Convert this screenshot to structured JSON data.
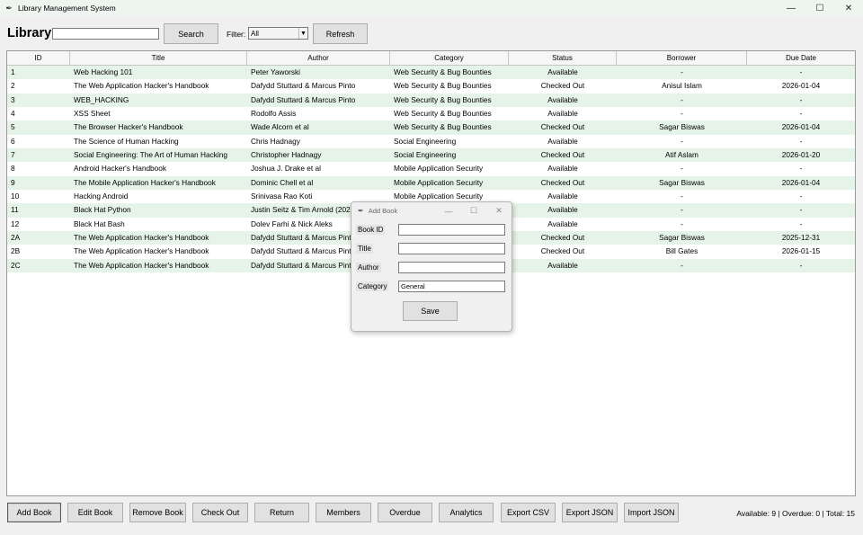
{
  "window": {
    "title": "Library Management System"
  },
  "toolbar": {
    "heading": "Library",
    "search_value": "",
    "search_button": "Search",
    "filter_label": "Filter:",
    "filter_value": "All",
    "refresh_button": "Refresh"
  },
  "table": {
    "columns": [
      "ID",
      "Title",
      "Author",
      "Category",
      "Status",
      "Borrower",
      "Due Date"
    ],
    "rows": [
      [
        "1",
        "Web Hacking 101",
        "Peter Yaworski",
        "Web Security & Bug Bounties",
        "Available",
        "-",
        "-"
      ],
      [
        "2",
        "The Web Application Hacker's Handbook",
        "Dafydd Stuttard & Marcus Pinto",
        "Web Security & Bug Bounties",
        "Checked Out",
        "Anisul Islam",
        "2026-01-04"
      ],
      [
        "3",
        "WEB_HACKING",
        "Dafydd Stuttard & Marcus Pinto",
        "Web Security & Bug Bounties",
        "Available",
        "-",
        "-"
      ],
      [
        "4",
        "XSS Sheet",
        "Rodolfo Assis",
        "Web Security & Bug Bounties",
        "Available",
        "-",
        "-"
      ],
      [
        "5",
        "The Browser Hacker's Handbook",
        "Wade Alcorn et al",
        "Web Security & Bug Bounties",
        "Checked Out",
        "Sagar Biswas",
        "2026-01-04"
      ],
      [
        "6",
        "The Science of Human Hacking",
        "Chris Hadnagy",
        "Social Engineering",
        "Available",
        "-",
        "-"
      ],
      [
        "7",
        "Social Engineering: The Art of Human Hacking",
        "Christopher Hadnagy",
        "Social Engineering",
        "Checked Out",
        "Atif Aslam",
        "2026-01-20"
      ],
      [
        "8",
        "Android Hacker's Handbook",
        "Joshua J. Drake et al",
        "Mobile Application Security",
        "Available",
        "-",
        "-"
      ],
      [
        "9",
        "The Mobile Application Hacker's Handbook",
        "Dominic Chell et al",
        "Mobile Application Security",
        "Checked Out",
        "Sagar Biswas",
        "2026-01-04"
      ],
      [
        "10",
        "Hacking Android",
        "Srinivasa Rao Koti",
        "Mobile Application Security",
        "Available",
        "-",
        "-"
      ],
      [
        "11",
        "Black Hat Python",
        "Justin Seitz & Tim Arnold (2021)",
        "",
        "Available",
        "-",
        "-"
      ],
      [
        "12",
        "Black Hat Bash",
        "Dolev Farhi & Nick Aleks",
        "",
        "Available",
        "-",
        "-"
      ],
      [
        "2A",
        "The Web Application Hacker's Handbook",
        "Dafydd Stuttard & Marcus Pinto",
        "",
        "Checked Out",
        "Sagar Biswas",
        "2025-12-31"
      ],
      [
        "2B",
        "The Web Application Hacker's Handbook",
        "Dafydd Stuttard & Marcus Pinto",
        "",
        "Checked Out",
        "Bill Gates",
        "2026-01-15"
      ],
      [
        "2C",
        "The Web Application Hacker's Handbook",
        "Dafydd Stuttard & Marcus Pinto",
        "",
        "Available",
        "-",
        "-"
      ]
    ]
  },
  "bottom": {
    "buttons": [
      "Add Book",
      "Edit Book",
      "Remove Book",
      "Check Out",
      "Return",
      "Members",
      "Overdue",
      "Analytics",
      "Export CSV",
      "Export JSON",
      "Import JSON"
    ],
    "status": "Available: 9 | Overdue: 0 | Total: 15"
  },
  "dialog": {
    "title": "Add Book",
    "fields": [
      {
        "label": "Book ID",
        "value": ""
      },
      {
        "label": "Title",
        "value": ""
      },
      {
        "label": "Author",
        "value": ""
      },
      {
        "label": "Category",
        "value": "General"
      }
    ],
    "save_button": "Save"
  },
  "colors": {
    "row_alt": "#e5f3e8",
    "button_face": "#e1e1e1"
  }
}
